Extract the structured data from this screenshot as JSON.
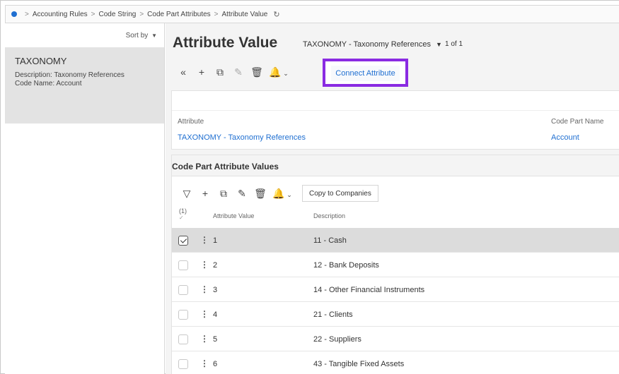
{
  "breadcrumb": {
    "items": [
      "Accounting Rules",
      "Code String",
      "Code Part Attributes",
      "Attribute Value"
    ]
  },
  "left_pane": {
    "sort_label": "Sort by",
    "record": {
      "title": "TAXONOMY",
      "description_label": "Description:",
      "description_value": "Taxonomy References",
      "code_name_label": "Code Name:",
      "code_name_value": "Account"
    }
  },
  "header": {
    "title": "Attribute Value",
    "subtitle": "TAXONOMY - Taxonomy References",
    "count": "1 of 1"
  },
  "toolbar": {
    "connect_label": "Connect Attribute",
    "icons": [
      "collapse-icon",
      "add-icon",
      "duplicate-icon",
      "edit-icon",
      "delete-icon",
      "bell-icon"
    ]
  },
  "detail": {
    "attribute_label": "Attribute",
    "attribute_value": "TAXONOMY - Taxonomy References",
    "code_part_name_label": "Code Part Name",
    "code_part_name_value": "Account"
  },
  "values_card": {
    "title": "Code Part Attribute Values",
    "copy_label": "Copy to Companies",
    "selected_count": "(1)",
    "columns": [
      "Attribute Value",
      "Description"
    ],
    "rows": [
      {
        "value": "1",
        "description": "11 - Cash",
        "selected": true
      },
      {
        "value": "2",
        "description": "12 - Bank Deposits",
        "selected": false
      },
      {
        "value": "3",
        "description": "14 - Other Financial Instruments",
        "selected": false
      },
      {
        "value": "4",
        "description": "21 - Clients",
        "selected": false
      },
      {
        "value": "5",
        "description": "22 - Suppliers",
        "selected": false
      },
      {
        "value": "6",
        "description": "43 - Tangible Fixed Assets",
        "selected": false
      }
    ]
  },
  "colors": {
    "accent": "#1f6fd1",
    "highlight": "#8a2be2",
    "selected_row": "#dcdcdc"
  }
}
